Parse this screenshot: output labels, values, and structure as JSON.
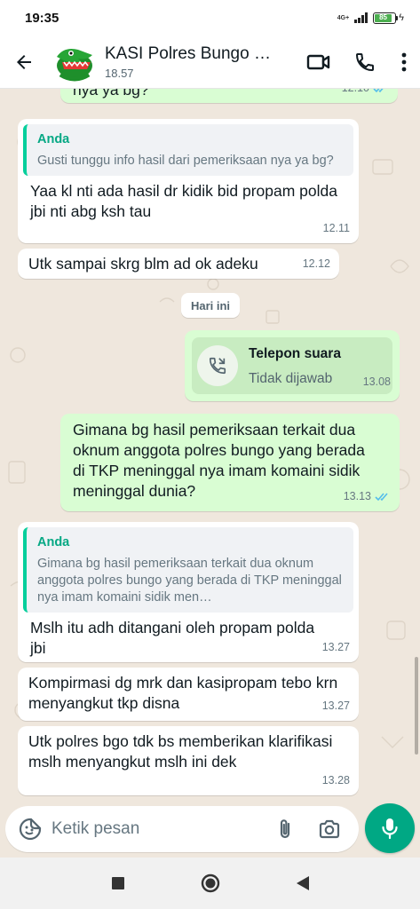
{
  "status_bar": {
    "time": "19:35",
    "network_top": "4G+",
    "network_bottom": "ıll",
    "battery": "85"
  },
  "header": {
    "title": "KASI Polres Bungo Siti Zubaidah",
    "subtitle": "18.57"
  },
  "messages": [
    {
      "type": "out",
      "text": "nya ya bg?",
      "time": "12.10",
      "ticks": "read"
    },
    {
      "type": "in",
      "quote_author": "Anda",
      "quote_text": "Gusti tunggu info hasil dari pemeriksaan nya ya bg?",
      "text": "Yaa kl nti ada hasil dr kidik bid propam polda jbi nti abg ksh tau",
      "time": "12.11"
    },
    {
      "type": "in",
      "text": "Utk sampai skrg blm ad ok adeku",
      "time": "12.12"
    },
    {
      "type": "call",
      "call_title": "Telepon suara",
      "call_status": "Tidak dijawab",
      "time": "13.08"
    },
    {
      "type": "out",
      "text": "Gimana bg hasil pemeriksaan terkait dua oknum anggota polres bungo yang berada di TKP meninggal nya imam komaini sidik meninggal dunia?",
      "time": "13.13",
      "ticks": "read"
    },
    {
      "type": "in",
      "quote_author": "Anda",
      "quote_text": "Gimana bg hasil pemeriksaan terkait dua oknum anggota polres bungo yang berada di TKP meninggal nya imam komaini sidik men…",
      "text": "Mslh itu adh ditangani oleh propam polda jbi",
      "time": "13.27"
    },
    {
      "type": "in",
      "text": "Kompirmasi dg mrk dan kasipropam tebo krn menyangkut tkp disna",
      "time": "13.27"
    },
    {
      "type": "in",
      "text": "Utk polres bgo tdk bs memberikan klarifikasi mslh menyangkut mslh ini dek",
      "time": "13.28"
    }
  ],
  "day_divider": "Hari ini",
  "composer": {
    "placeholder": "Ketik pesan"
  },
  "colors": {
    "outgoing_bubble": "#d9fdd3",
    "incoming_bubble": "#ffffff",
    "accent": "#00a884",
    "read_ticks": "#53bdeb",
    "quote_bar": "#06cf9c",
    "missed_call": "#54656f"
  },
  "icons": {
    "back": "arrow-left-icon",
    "video": "video-call-icon",
    "call": "phone-icon",
    "menu": "more-vert-icon",
    "sticker": "sticker-icon",
    "attach": "paperclip-icon",
    "camera": "camera-icon",
    "mic": "mic-icon",
    "missed": "missed-call-icon"
  }
}
